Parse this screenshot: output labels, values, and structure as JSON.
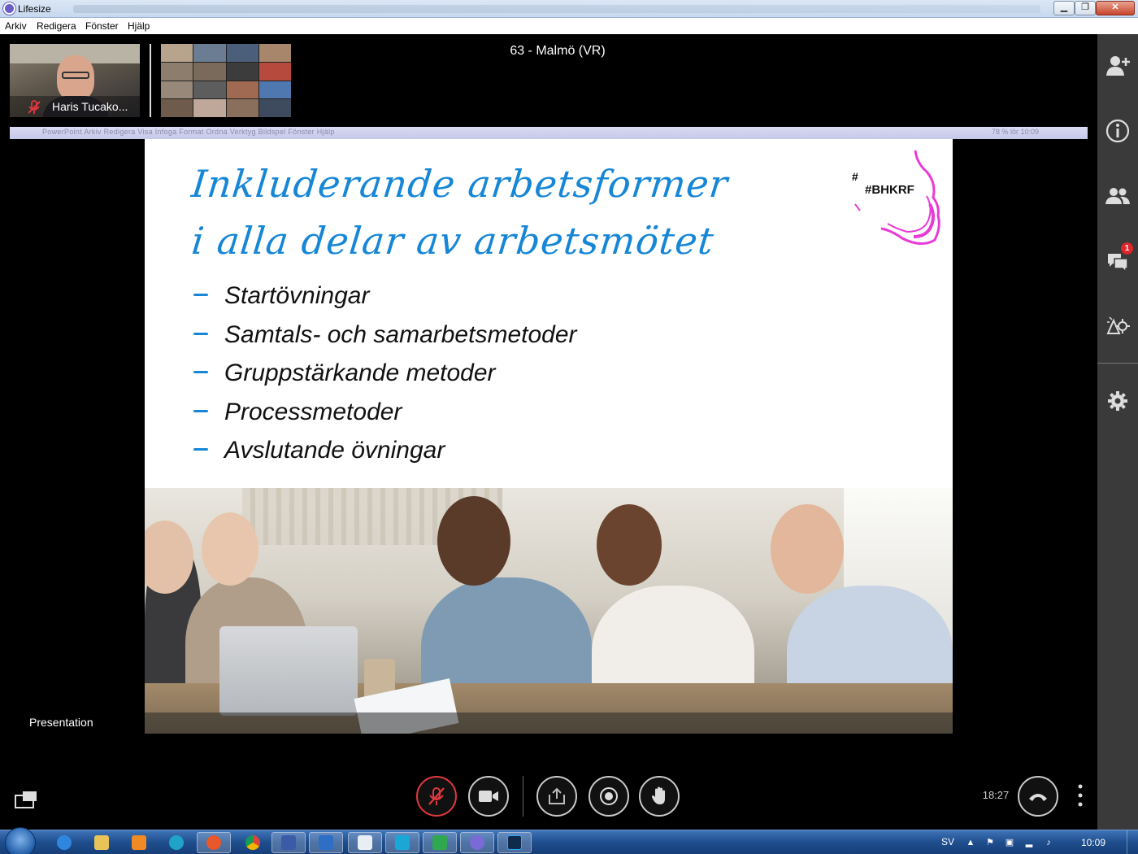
{
  "window": {
    "title": "Lifesize",
    "minimize_glyph": "▁",
    "maximize_glyph": "❐",
    "close_glyph": "✕"
  },
  "menu": {
    "items": [
      "Arkiv",
      "Redigera",
      "Fönster",
      "Hjälp"
    ]
  },
  "call": {
    "meeting_title": "63 - Malmö (VR)",
    "self_name": "Haris Tucako...",
    "self_mic_state": "muted",
    "presentation_label": "Presentation",
    "timer": "18:27"
  },
  "shared_screen": {
    "mac_menu": "PowerPoint   Arkiv   Redigera   Visa   Infoga   Format   Ordna   Verktyg   Bildspel   Fönster   Hjälp",
    "mac_status": "78 %   lör 10:09",
    "slide": {
      "heading_line1": "Inkluderande arbetsformer",
      "heading_line2": "i alla delar av arbetsmötet",
      "bullets": [
        "Startövningar",
        "Samtals- och samarbetsmetoder",
        "Gruppstärkande metoder",
        "Processmetoder",
        "Avslutande övningar"
      ],
      "logo_hash": "#",
      "logo_tag": "#BHKRF",
      "accent_color": "#1686d6",
      "logo_color": "#e83ad6"
    }
  },
  "controls": {
    "buttons": [
      "mute-microphone",
      "camera",
      "share-screen",
      "record",
      "raise-hand",
      "hang-up"
    ],
    "mute_color": "#e0383e"
  },
  "sidebar": {
    "buttons": [
      "add-participant-icon",
      "info-icon",
      "participants-icon",
      "chat-icon",
      "presentation-settings-icon",
      "settings-icon"
    ],
    "chat_badge": "1"
  },
  "taskbar": {
    "language": "SV",
    "clock": "10:09",
    "apps": [
      "internet-explorer",
      "file-explorer",
      "media-player",
      "edge",
      "firefox",
      "chrome",
      "save-app",
      "outlook",
      "notepad",
      "malwarebytes",
      "security",
      "lifesize",
      "photoshop"
    ]
  }
}
